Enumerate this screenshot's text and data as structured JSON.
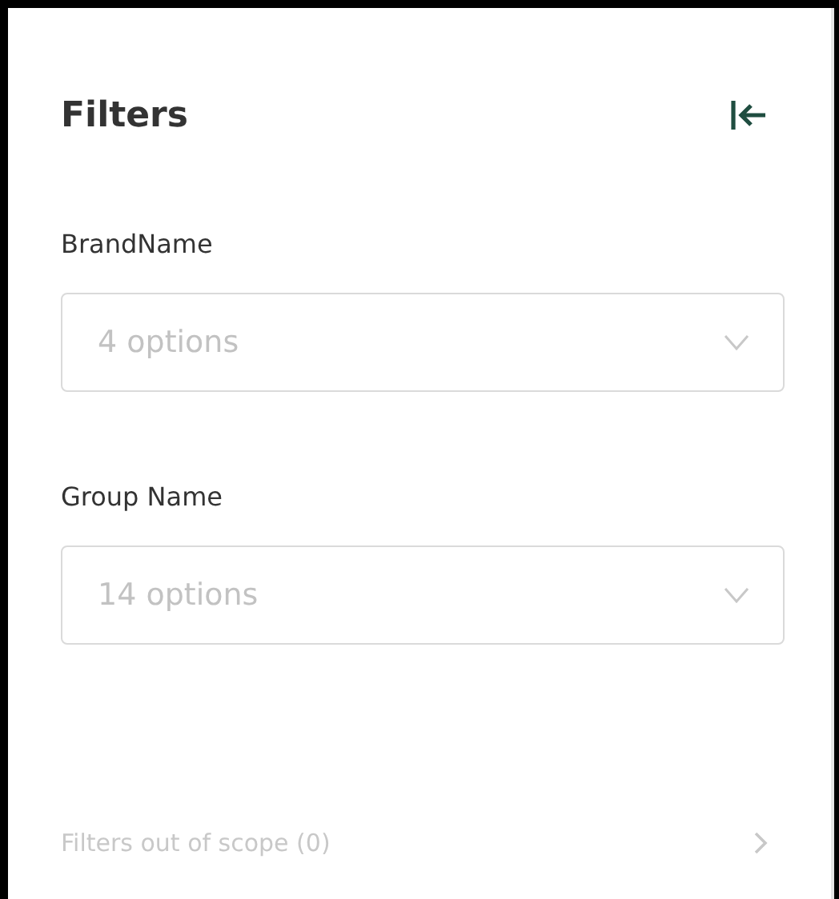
{
  "panel": {
    "title": "Filters"
  },
  "filters": [
    {
      "label": "BrandName",
      "placeholder": "4 options"
    },
    {
      "label": "Group Name",
      "placeholder": "14 options"
    }
  ],
  "out_of_scope": {
    "label": "Filters out of scope (0)",
    "expanded": false
  }
}
